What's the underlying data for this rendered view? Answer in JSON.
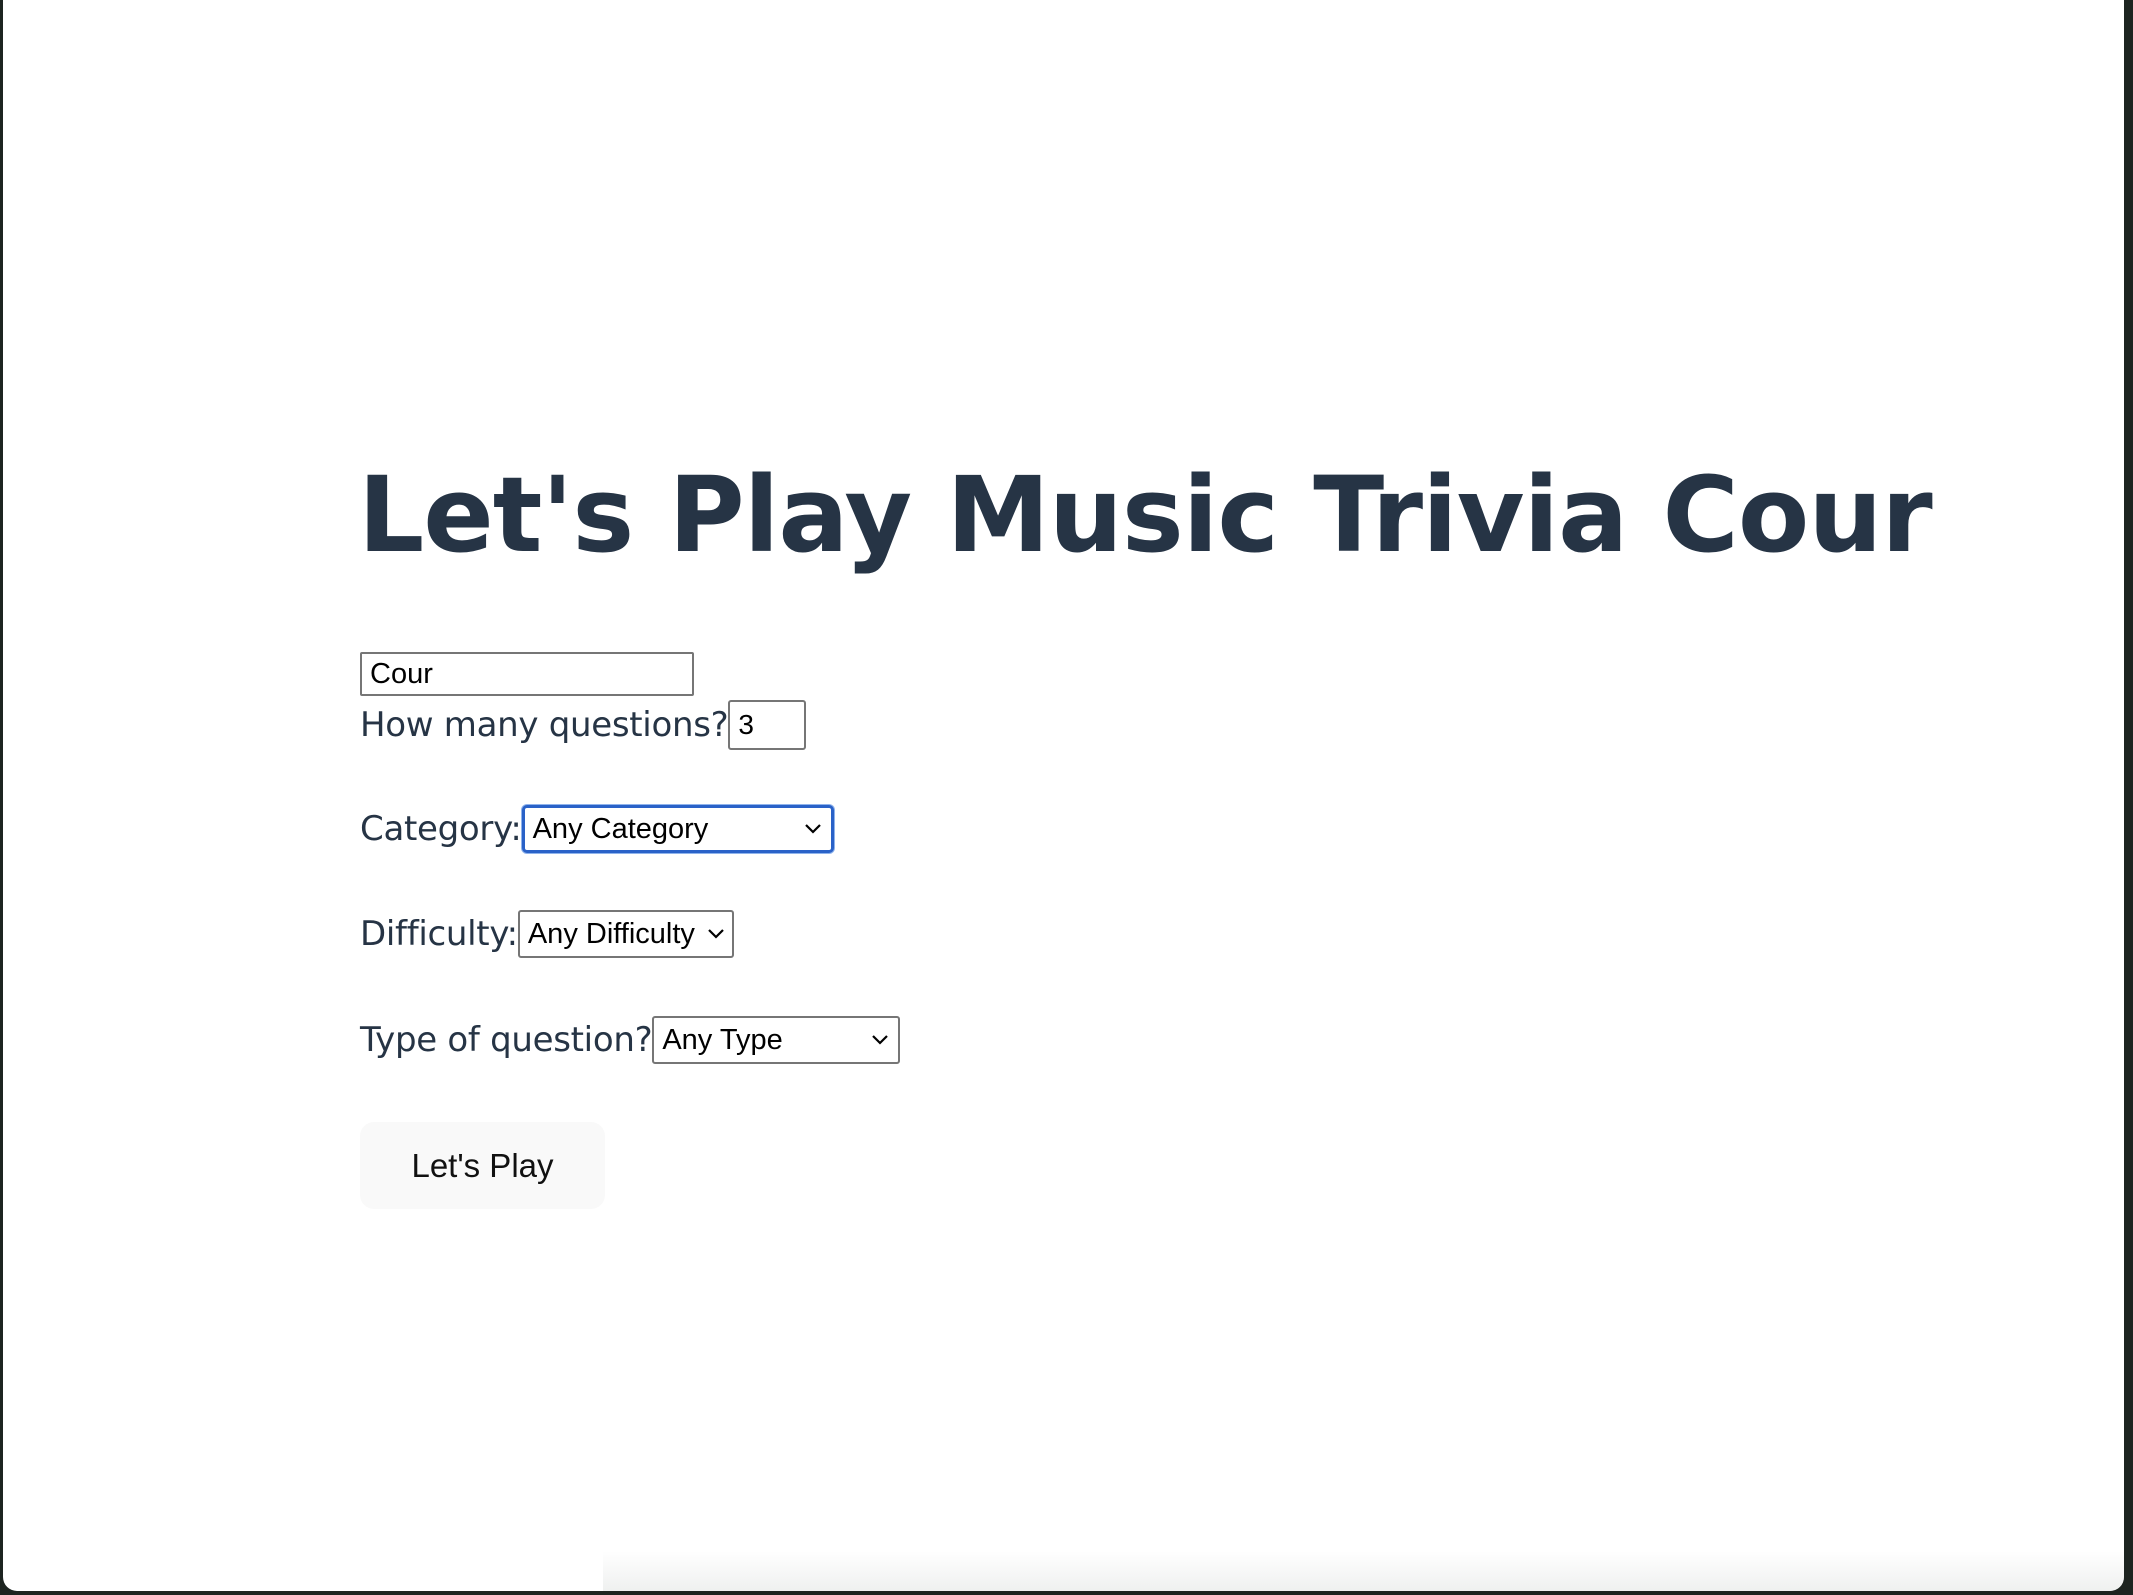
{
  "heading": "Let's Play Music Trivia Cour",
  "form": {
    "name_value": "Cour",
    "questions_label": "How many questions?",
    "questions_value": "3",
    "category_label": "Category:",
    "category_value": "Any Category",
    "difficulty_label": "Difficulty:",
    "difficulty_value": "Any Difficulty",
    "type_label": "Type of question?",
    "type_value": "Any Type",
    "submit_label": "Let's Play"
  },
  "colors": {
    "heading": "#263445",
    "focus_ring": "#2a62c8",
    "button_bg": "#f9f9f9"
  },
  "icons": {
    "select_arrow": "chevron-down-icon"
  }
}
